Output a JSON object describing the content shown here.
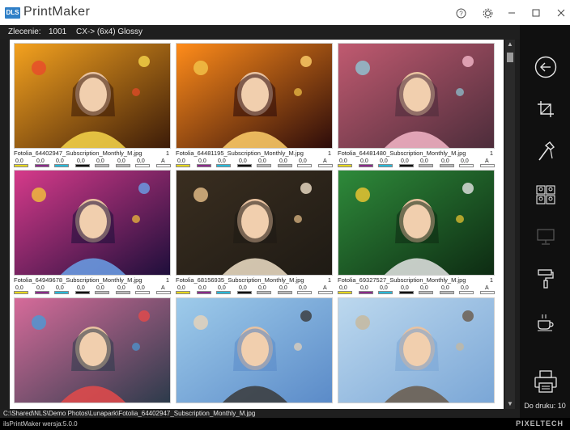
{
  "app": {
    "logo": "DLS",
    "title": "PrintMaker",
    "version": "ilsPrintMaker wersja:5.0.0",
    "brand": "PIXELTECH"
  },
  "window_controls": [
    "help-icon",
    "settings-icon",
    "minimize-icon",
    "maximize-icon",
    "close-icon"
  ],
  "order": {
    "label": "Zlecenie:",
    "number": "1001",
    "format": "CX-> (6x4) Glossy"
  },
  "photos": [
    {
      "file": "Fotolia_64402947_Subscription_Monthly_M.jpg",
      "qty": "1",
      "values": [
        "0,0",
        "0,0",
        "0,0",
        "0,0",
        "0,0",
        "0,0",
        "0,0"
      ],
      "mode": "A"
    },
    {
      "file": "Fotolia_64481195_Subscription_Monthly_M.jpg",
      "qty": "1",
      "values": [
        "0,0",
        "0,0",
        "0,0",
        "0,0",
        "0,0",
        "0,0",
        "0,0"
      ],
      "mode": "A"
    },
    {
      "file": "Fotolia_64481480_Subscription_Monthly_M.jpg",
      "qty": "1",
      "values": [
        "0,0",
        "0,0",
        "0,0",
        "0,0",
        "0,0",
        "0,0",
        "0,0"
      ],
      "mode": "A"
    },
    {
      "file": "Fotolia_64949678_Subscription_Monthly_M.jpg",
      "qty": "1",
      "values": [
        "0,0",
        "0,0",
        "0,0",
        "0,0",
        "0,0",
        "0,0",
        "0,0"
      ],
      "mode": "A"
    },
    {
      "file": "Fotolia_68156935_Subscription_Monthly_M.jpg",
      "qty": "1",
      "values": [
        "0,0",
        "0,0",
        "0,0",
        "0,0",
        "0,0",
        "0,0",
        "0,0"
      ],
      "mode": "A"
    },
    {
      "file": "Fotolia_69327527_Subscription_Monthly_M.jpg",
      "qty": "1",
      "values": [
        "0,0",
        "0,0",
        "0,0",
        "0,0",
        "0,0",
        "0,0",
        "0,0"
      ],
      "mode": "A"
    },
    {
      "file": "",
      "qty": "",
      "values": [],
      "mode": ""
    },
    {
      "file": "",
      "qty": "",
      "values": [],
      "mode": ""
    },
    {
      "file": "",
      "qty": "",
      "values": [],
      "mode": ""
    }
  ],
  "swatch_colors": [
    "#e8d81e",
    "#8a2a8a",
    "#27b9d9",
    "#111111",
    "#bbbbbb",
    "#ffffff"
  ],
  "sidebar": {
    "icons": [
      "back-icon",
      "crop-icon",
      "tools-icon",
      "faces-icon",
      "monitor-icon",
      "paint-roller-icon",
      "coffee-icon",
      "printer-icon"
    ],
    "print_label": "Do druku: 10"
  },
  "path": "C:\\Shared\\NLS\\Demo Photos\\Lunapark\\Fotolia_64402947_Subscription_Monthly_M.jpg"
}
